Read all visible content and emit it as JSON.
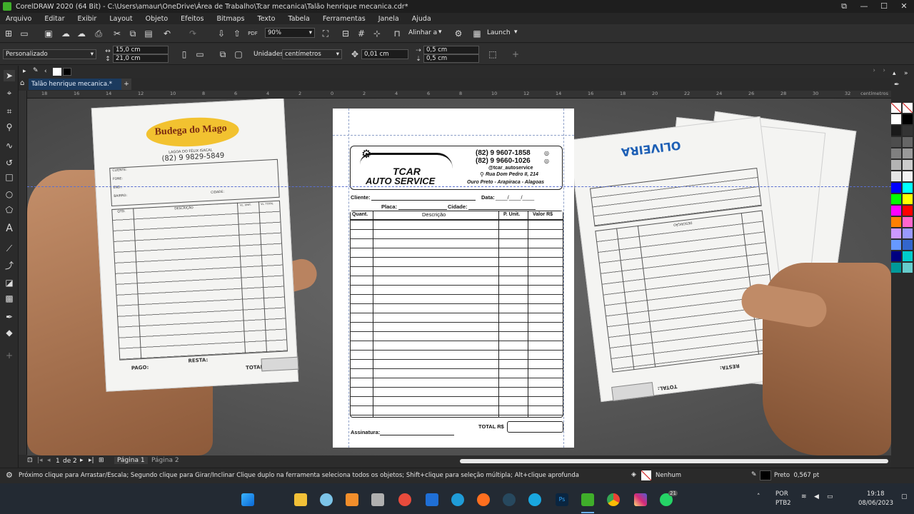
{
  "window": {
    "title": "CorelDRAW 2020 (64 Bit) - C:\\Users\\amaur\\OneDrive\\Área de Trabalho\\Tcar mecanica\\Talão henrique mecanica.cdr*",
    "buttons": [
      "⧉",
      "—",
      "☐",
      "✕"
    ]
  },
  "menu": [
    "Arquivo",
    "Editar",
    "Exibir",
    "Layout",
    "Objeto",
    "Efeitos",
    "Bitmaps",
    "Texto",
    "Tabela",
    "Ferramentas",
    "Janela",
    "Ajuda"
  ],
  "toolbar": {
    "zoom": "90%",
    "align_label": "Alinhar a",
    "launch_label": "Launch"
  },
  "properties": {
    "preset": "Personalizado",
    "width": "15,0 cm",
    "height": "21,0 cm",
    "units_label": "Unidades:",
    "units_value": "centímetros",
    "nudge": "0,01 cm",
    "dup_x": "0,5 cm",
    "dup_y": "0,5 cm"
  },
  "document_tab": "Talão henrique mecanica.*",
  "ruler_unit": "centímetros",
  "ruler_ticks": [
    "18",
    "16",
    "14",
    "12",
    "10",
    "8",
    "6",
    "4",
    "2",
    "0",
    "2",
    "4",
    "6",
    "8",
    "10",
    "12",
    "14",
    "16",
    "18",
    "20",
    "22",
    "24",
    "26",
    "28",
    "30",
    "32"
  ],
  "invoice": {
    "phone1": "(82) 9 9607-1858",
    "phone2": "(82) 9 9660-1026",
    "instagram": "@tcar_autoservice",
    "address": "Rua Dom Pedro II, 214",
    "city": "Ouro Preto - Arapiraca - Alagoas",
    "brand_top": "TCAR",
    "brand_bottom": "AUTO SERVICE",
    "cliente_label": "Cliente:",
    "data_label": "Data:",
    "date_blank": "____/____/____",
    "placa_label": "Placa:",
    "cidade_label": "Cidade:",
    "col_quant": "Quant.",
    "col_desc": "Descrição",
    "col_unit": "P. Unit.",
    "col_valor": "Valor R$",
    "total_label": "TOTAL R$",
    "assinatura_label": "Assinatura:"
  },
  "left_pad": {
    "brand": "Budega do Mago",
    "sub": "LAGOA DO FÉLIX ISACAL",
    "phone": "(82) 9 9829-5849",
    "cliente": "CLIENTE:",
    "fone": "FONE:",
    "end": "END.:",
    "bairro": "BAIRRO:",
    "cidade": "CIDADE:",
    "qtd": "QTD.",
    "desc": "DESCRIÇÃO",
    "vunit": "VL. UNIT.",
    "vtotal": "VL. TOTAL",
    "pago": "PAGO:",
    "resta": "RESTA:",
    "total": "TOTAL:"
  },
  "right_pad": {
    "brand": "OLIVEIRA",
    "total": "TOTAL:",
    "resta": "RESTA:",
    "desc": "DESCRIÇÃO"
  },
  "pages": {
    "current": "1",
    "of_label": "de",
    "count": "2",
    "tab1": "Página 1",
    "tab2": "Página 2"
  },
  "status": {
    "hint": "Próximo clique para Arrastar/Escala; Segundo clique para Girar/Inclinar Clique duplo na ferramenta seleciona todos os objetos; Shift+clique para seleção múltipla; Alt+clique aprofunda",
    "fill": "Nenhum",
    "outline": "Preto  0,567 pt"
  },
  "taskbar": {
    "lang1": "POR",
    "lang2": "PTB2",
    "time": "19:18",
    "date": "08/06/2023",
    "badge": "21"
  },
  "colors": {
    "accent": "#1b3a5e",
    "palette": [
      "#ffffff",
      "#000000",
      "#1a1a1a",
      "#333333",
      "#4d4d4d",
      "#666666",
      "#808080",
      "#999999",
      "#b3b3b3",
      "#cccccc",
      "#e6e6e6",
      "#f2f2f2",
      "#0000ff",
      "#00ffff",
      "#00ff00",
      "#ffff00",
      "#ff00ff",
      "#ff0000",
      "#ff8000",
      "#ff66cc",
      "#cc99ff",
      "#9999ff",
      "#6699ff",
      "#3366cc",
      "#000080",
      "#00cccc",
      "#009999",
      "#66cccc"
    ]
  }
}
